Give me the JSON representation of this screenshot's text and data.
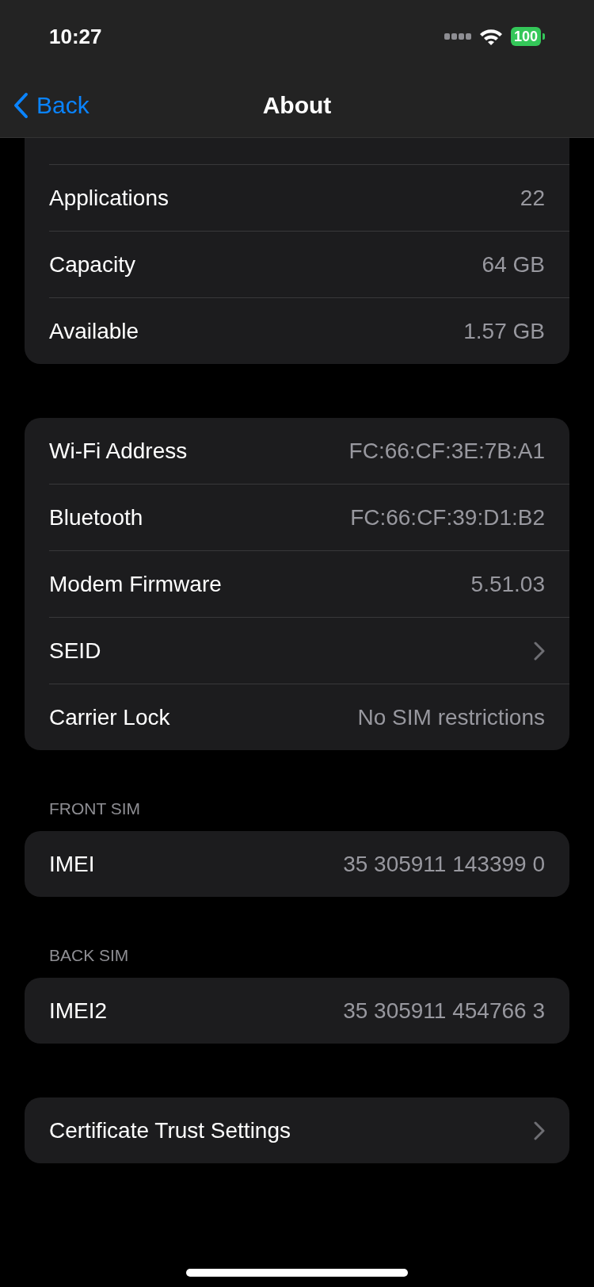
{
  "status_bar": {
    "time": "10:27",
    "battery": "100"
  },
  "nav": {
    "back": "Back",
    "title": "About"
  },
  "sections": [
    {
      "cut_top": true,
      "rows": [
        {
          "kind": "value",
          "label": "Applications",
          "value": "22"
        },
        {
          "kind": "value",
          "label": "Capacity",
          "value": "64 GB"
        },
        {
          "kind": "value",
          "label": "Available",
          "value": "1.57 GB"
        }
      ]
    },
    {
      "cut_top": false,
      "rows": [
        {
          "kind": "value",
          "label": "Wi-Fi Address",
          "value": "FC:66:CF:3E:7B:A1"
        },
        {
          "kind": "value",
          "label": "Bluetooth",
          "value": "FC:66:CF:39:D1:B2"
        },
        {
          "kind": "value",
          "label": "Modem Firmware",
          "value": "5.51.03"
        },
        {
          "kind": "link",
          "label": "SEID"
        },
        {
          "kind": "value",
          "label": "Carrier Lock",
          "value": "No SIM restrictions"
        }
      ]
    },
    {
      "cut_top": false,
      "header": "FRONT SIM",
      "rows": [
        {
          "kind": "value",
          "label": "IMEI",
          "value": "35 305911 143399 0"
        }
      ]
    },
    {
      "cut_top": false,
      "header": "BACK SIM",
      "rows": [
        {
          "kind": "value",
          "label": "IMEI2",
          "value": "35 305911 454766 3"
        }
      ]
    },
    {
      "cut_top": false,
      "rows": [
        {
          "kind": "link",
          "label": "Certificate Trust Settings"
        }
      ]
    }
  ]
}
